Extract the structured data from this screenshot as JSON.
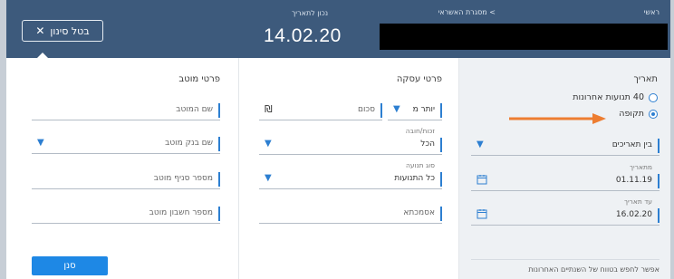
{
  "header": {
    "home_crumb": "ראשי",
    "current_crumb": "> מסגרת האשראי",
    "date_label": "נכון לתאריך",
    "date_value": "14.02.20",
    "cancel_filter": "בטל סינון",
    "cancel_icon": "close-icon"
  },
  "date_panel": {
    "title": "תאריך",
    "radio_recent": "40 תנועות אחרונות",
    "radio_period": "תקופה",
    "range_select": "בין תאריכים",
    "from_label": "מתאריך",
    "from_value": "01.11.19",
    "to_label": "עד תאריך",
    "to_value": "16.02.20",
    "note": "אפשר לחפש בטווח של השנתיים האחרונות"
  },
  "deal_panel": {
    "title": "פרטי עסקה",
    "amount_op": "יותר מ",
    "amount_placeholder": "סכום",
    "currency_symbol": "₪",
    "debit_credit_label": "זכות/חובה",
    "debit_credit_value": "הכל",
    "type_label": "סוג תנועה",
    "type_value": "כל התנועות",
    "reference_placeholder": "אסמכתא"
  },
  "payee_panel": {
    "title": "פרטי מוטב",
    "name_placeholder": "שם המוטב",
    "bank_placeholder": "שם בנק מוטב",
    "branch_placeholder": "מספר סניף מוטב",
    "account_placeholder": "מספר חשבון מוטב",
    "filter_button": "סנן"
  },
  "colors": {
    "header_bg": "#3d5a7c",
    "accent": "#2d7fd1",
    "button": "#1e88e5",
    "annotation_arrow": "#ed7d31"
  }
}
